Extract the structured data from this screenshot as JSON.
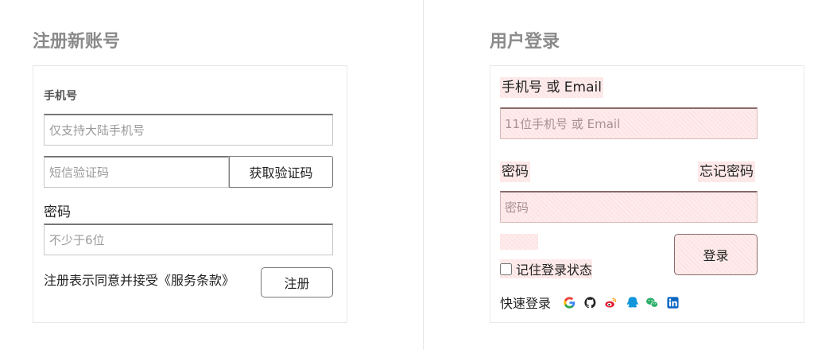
{
  "register": {
    "title": "注册新账号",
    "phone_label": "手机号",
    "phone_placeholder": "仅支持大陆手机号",
    "sms_placeholder": "短信验证码",
    "sms_button": "获取验证码",
    "password_label": "密码",
    "password_placeholder": "不少于6位",
    "terms_text": "注册表示同意并接受《服务条款》",
    "submit_button": "注册"
  },
  "login": {
    "title": "用户登录",
    "id_label": "手机号 或 Email",
    "id_placeholder": "11位手机号 或 Email",
    "password_label": "密码",
    "forgot_link": "忘记密码",
    "password_placeholder": "密码",
    "remember_label": "记住登录状态",
    "submit_button": "登录",
    "quick_login_label": "快速登录",
    "social_icons": [
      "google-icon",
      "github-icon",
      "weibo-icon",
      "qq-icon",
      "wechat-icon",
      "linkedin-icon"
    ]
  },
  "colors": {
    "section_title": "#8a8a8a",
    "highlight": "#fde4e4",
    "google_blue": "#4285f4",
    "weibo_red": "#e6162d",
    "qq_blue": "#1296db",
    "wechat_green": "#2aae67",
    "linkedin_blue": "#0a66c2"
  }
}
